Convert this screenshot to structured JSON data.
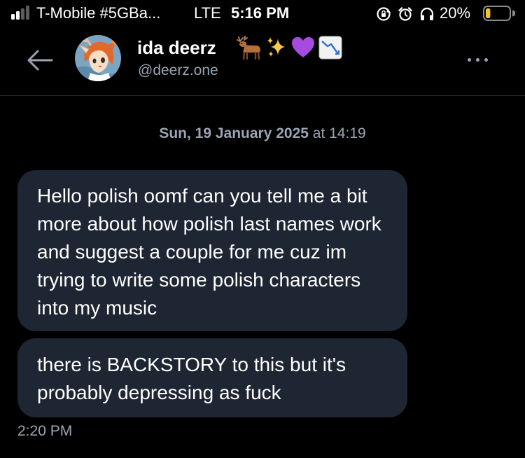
{
  "status_bar": {
    "carrier": "T-Mobile #5GBa...",
    "network": "LTE",
    "time": "5:16 PM",
    "battery_percent": "20%",
    "battery_level": 0.2,
    "signal_bars_filled": 2,
    "signal_bars_total": 4,
    "icons": [
      "rotation-lock-icon",
      "alarm-icon",
      "headphones-icon"
    ],
    "battery_color": "#f4c430"
  },
  "header": {
    "display_name": "ida deerz",
    "name_emojis": [
      "deer-emoji-icon",
      "sparkles-emoji-icon",
      "purple-heart-emoji-icon",
      "chart-decreasing-emoji-icon"
    ],
    "handle": "@deerz.one"
  },
  "conversation": {
    "date_day": "Sun, 19 January 2025",
    "date_time": "at 14:19",
    "messages": [
      {
        "text": "Hello polish oomf can you tell me a bit more about how polish last names work and suggest a couple for me cuz im trying to write some polish characters into my music"
      },
      {
        "text": "there is BACKSTORY to this but it's probably depressing as fuck"
      }
    ],
    "last_message_time": "2:20 PM"
  },
  "colors": {
    "background": "#000000",
    "bubble": "#1e2533",
    "muted_text": "#9aa4b3",
    "accent": "#8fb4ff"
  }
}
